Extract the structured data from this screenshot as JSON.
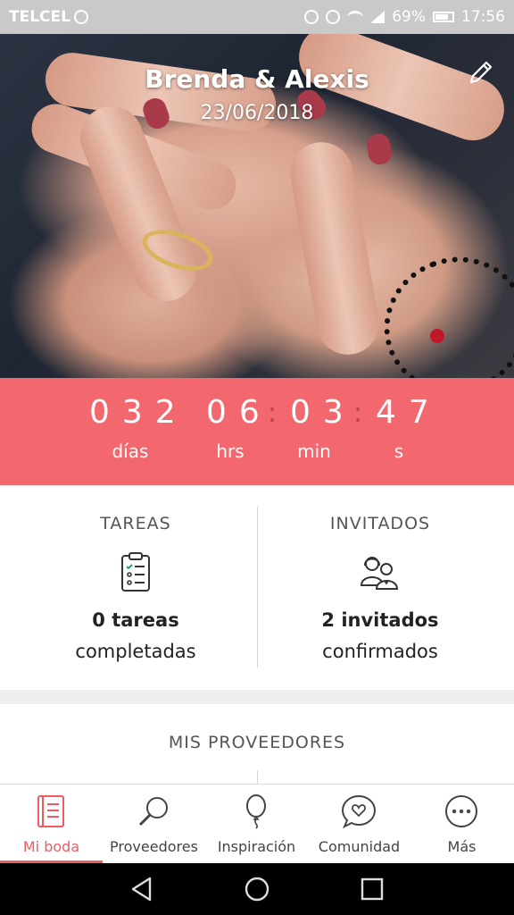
{
  "status_bar": {
    "carrier": "TELCEL",
    "battery": "69%",
    "time": "17:56"
  },
  "hero": {
    "title": "Brenda & Alexis",
    "date": "23/06/2018"
  },
  "countdown": {
    "days": "032",
    "hours": "06",
    "minutes": "03",
    "seconds": "47",
    "days_label": "días",
    "hours_label": "hrs",
    "minutes_label": "min",
    "seconds_label": "s"
  },
  "tasks": {
    "title": "TAREAS",
    "count": "0 tareas",
    "sub": "completadas",
    "icon": "clipboard-checklist-icon"
  },
  "guests": {
    "title": "INVITADOS",
    "count": "2 invitados",
    "sub": "confirmados",
    "icon": "couple-icon"
  },
  "providers": {
    "title": "MIS PROVEEDORES"
  },
  "tabbar": {
    "active": "Mi boda",
    "items": [
      {
        "label": "Mi boda",
        "icon": "notebook-icon"
      },
      {
        "label": "Proveedores",
        "icon": "magnifier-icon"
      },
      {
        "label": "Inspiración",
        "icon": "balloon-icon"
      },
      {
        "label": "Comunidad",
        "icon": "chat-heart-icon"
      },
      {
        "label": "Más",
        "icon": "more-dots-icon"
      }
    ]
  },
  "colors": {
    "accent": "#f05a61",
    "countdown_bg": "#f2686e",
    "statusbar_bg": "#c9c9c9"
  }
}
